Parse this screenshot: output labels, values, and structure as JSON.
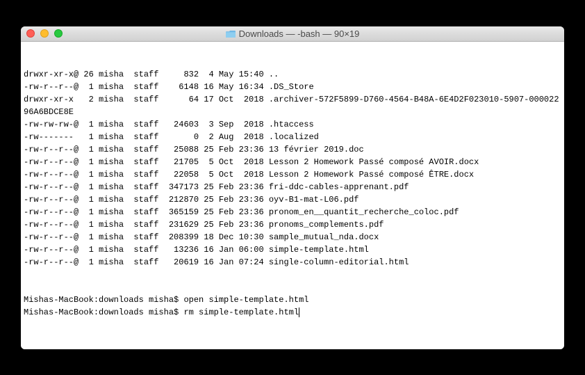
{
  "titlebar": {
    "title": "Downloads — -bash — 90×19"
  },
  "lines": [
    "drwxr-xr-x@ 26 misha  staff     832  4 May 15:40 ..",
    "-rw-r--r--@  1 misha  staff    6148 16 May 16:34 .DS_Store",
    "drwxr-xr-x   2 misha  staff      64 17 Oct  2018 .archiver-572F5899-D760-4564-B48A-6E4D2F023010-5907-00002296A6BDCE8E",
    "-rw-rw-rw-@  1 misha  staff   24603  3 Sep  2018 .htaccess",
    "-rw-------   1 misha  staff       0  2 Aug  2018 .localized",
    "-rw-r--r--@  1 misha  staff   25088 25 Feb 23:36 13 février 2019.doc",
    "-rw-r--r--@  1 misha  staff   21705  5 Oct  2018 Lesson 2 Homework Passé composé AVOIR.docx",
    "-rw-r--r--@  1 misha  staff   22058  5 Oct  2018 Lesson 2 Homework Passé composé ÊTRE.docx",
    "-rw-r--r--@  1 misha  staff  347173 25 Feb 23:36 fri-ddc-cables-apprenant.pdf",
    "-rw-r--r--@  1 misha  staff  212870 25 Feb 23:36 oyv-B1-mat-L06.pdf",
    "-rw-r--r--@  1 misha  staff  365159 25 Feb 23:36 pronom_en__quantit_recherche_coloc.pdf",
    "-rw-r--r--@  1 misha  staff  231629 25 Feb 23:36 pronoms_complements.pdf",
    "-rw-r--r--@  1 misha  staff  208399 18 Dec 10:30 sample_mutual_nda.docx",
    "-rw-r--r--@  1 misha  staff   13236 16 Jan 06:00 simple-template.html",
    "-rw-r--r--@  1 misha  staff   20619 16 Jan 07:24 single-column-editorial.html"
  ],
  "prompts": [
    {
      "prompt": "Mishas-MacBook:downloads misha$ ",
      "command": "open simple-template.html"
    },
    {
      "prompt": "Mishas-MacBook:downloads misha$ ",
      "command": "rm simple-template.html"
    }
  ]
}
